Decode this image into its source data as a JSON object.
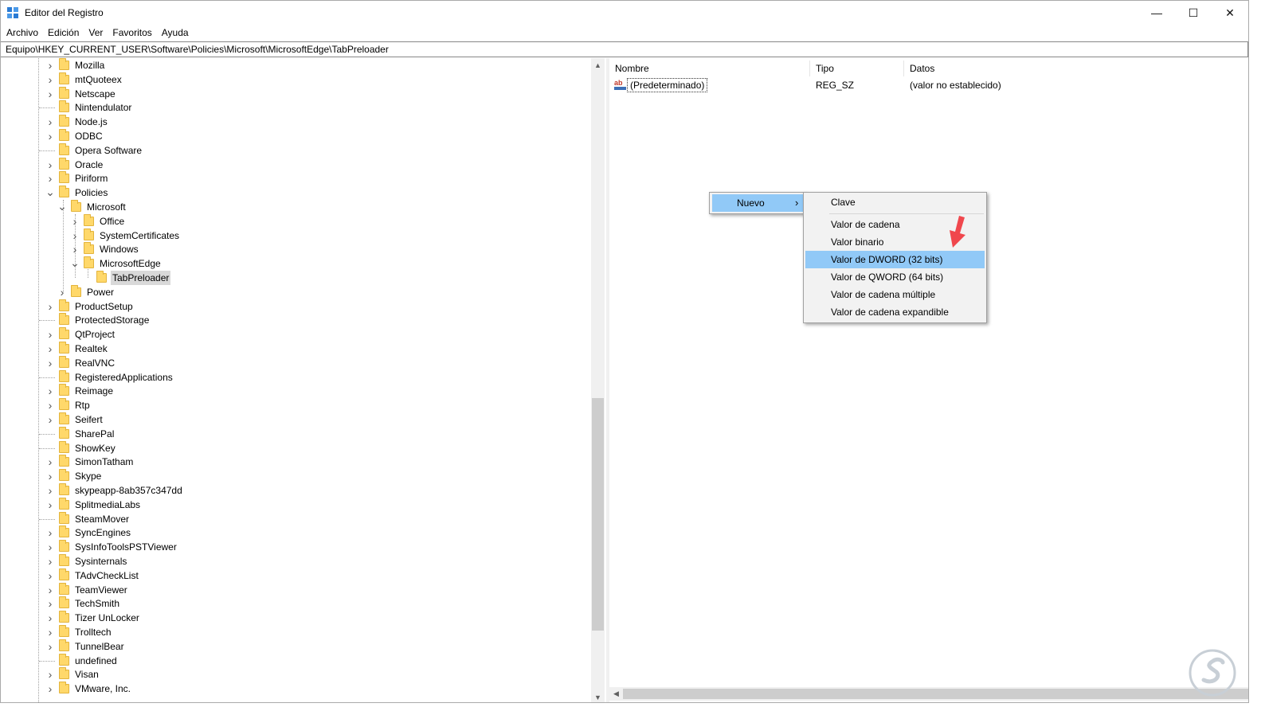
{
  "window": {
    "title": "Editor del Registro",
    "controls": {
      "minimize": "—",
      "maximize": "☐",
      "close": "✕"
    }
  },
  "menu": [
    "Archivo",
    "Edición",
    "Ver",
    "Favoritos",
    "Ayuda"
  ],
  "address": "Equipo\\HKEY_CURRENT_USER\\Software\\Policies\\Microsoft\\MicrosoftEdge\\TabPreloader",
  "tree": [
    {
      "label": "Mozilla",
      "level": 0,
      "expander": "collapsed"
    },
    {
      "label": "mtQuoteex",
      "level": 0,
      "expander": "collapsed"
    },
    {
      "label": "Netscape",
      "level": 0,
      "expander": "collapsed"
    },
    {
      "label": "Nintendulator",
      "level": 0,
      "expander": "none"
    },
    {
      "label": "Node.js",
      "level": 0,
      "expander": "collapsed"
    },
    {
      "label": "ODBC",
      "level": 0,
      "expander": "collapsed"
    },
    {
      "label": "Opera Software",
      "level": 0,
      "expander": "none"
    },
    {
      "label": "Oracle",
      "level": 0,
      "expander": "collapsed"
    },
    {
      "label": "Piriform",
      "level": 0,
      "expander": "collapsed"
    },
    {
      "label": "Policies",
      "level": 0,
      "expander": "expanded"
    },
    {
      "label": "Microsoft",
      "level": 1,
      "expander": "expanded"
    },
    {
      "label": "Office",
      "level": 2,
      "expander": "collapsed"
    },
    {
      "label": "SystemCertificates",
      "level": 2,
      "expander": "collapsed"
    },
    {
      "label": "Windows",
      "level": 2,
      "expander": "collapsed"
    },
    {
      "label": "MicrosoftEdge",
      "level": 2,
      "expander": "expanded"
    },
    {
      "label": "TabPreloader",
      "level": 3,
      "expander": "none",
      "selected": true
    },
    {
      "label": "Power",
      "level": 1,
      "expander": "collapsed"
    },
    {
      "label": "ProductSetup",
      "level": 0,
      "expander": "collapsed"
    },
    {
      "label": "ProtectedStorage",
      "level": 0,
      "expander": "none"
    },
    {
      "label": "QtProject",
      "level": 0,
      "expander": "collapsed"
    },
    {
      "label": "Realtek",
      "level": 0,
      "expander": "collapsed"
    },
    {
      "label": "RealVNC",
      "level": 0,
      "expander": "collapsed"
    },
    {
      "label": "RegisteredApplications",
      "level": 0,
      "expander": "none"
    },
    {
      "label": "Reimage",
      "level": 0,
      "expander": "collapsed"
    },
    {
      "label": "Rtp",
      "level": 0,
      "expander": "collapsed"
    },
    {
      "label": "Seifert",
      "level": 0,
      "expander": "collapsed"
    },
    {
      "label": "SharePal",
      "level": 0,
      "expander": "none"
    },
    {
      "label": "ShowKey",
      "level": 0,
      "expander": "none"
    },
    {
      "label": "SimonTatham",
      "level": 0,
      "expander": "collapsed"
    },
    {
      "label": "Skype",
      "level": 0,
      "expander": "collapsed"
    },
    {
      "label": "skypeapp-8ab357c347dd",
      "level": 0,
      "expander": "collapsed"
    },
    {
      "label": "SplitmediaLabs",
      "level": 0,
      "expander": "collapsed"
    },
    {
      "label": "SteamMover",
      "level": 0,
      "expander": "none"
    },
    {
      "label": "SyncEngines",
      "level": 0,
      "expander": "collapsed"
    },
    {
      "label": "SysInfoToolsPSTViewer",
      "level": 0,
      "expander": "collapsed"
    },
    {
      "label": "Sysinternals",
      "level": 0,
      "expander": "collapsed"
    },
    {
      "label": "TAdvCheckList",
      "level": 0,
      "expander": "collapsed"
    },
    {
      "label": "TeamViewer",
      "level": 0,
      "expander": "collapsed"
    },
    {
      "label": "TechSmith",
      "level": 0,
      "expander": "collapsed"
    },
    {
      "label": "Tizer UnLocker",
      "level": 0,
      "expander": "collapsed"
    },
    {
      "label": "Trolltech",
      "level": 0,
      "expander": "collapsed"
    },
    {
      "label": "TunnelBear",
      "level": 0,
      "expander": "collapsed"
    },
    {
      "label": "undefined",
      "level": 0,
      "expander": "none"
    },
    {
      "label": "Visan",
      "level": 0,
      "expander": "collapsed"
    },
    {
      "label": "VMware, Inc.",
      "level": 0,
      "expander": "collapsed"
    }
  ],
  "list": {
    "columns": [
      "Nombre",
      "Tipo",
      "Datos"
    ],
    "rows": [
      {
        "name": "(Predeterminado)",
        "type": "REG_SZ",
        "data": "(valor no establecido)",
        "icon": "ab"
      }
    ]
  },
  "context_menu": {
    "parent_item": "Nuevo",
    "parent_arrow": "›",
    "submenu": [
      {
        "label": "Clave"
      },
      {
        "label": "Valor de cadena"
      },
      {
        "label": "Valor binario"
      },
      {
        "label": "Valor de DWORD (32 bits)",
        "highlighted": true
      },
      {
        "label": "Valor de QWORD (64 bits)"
      },
      {
        "label": "Valor de cadena múltiple"
      },
      {
        "label": "Valor de cadena expandible"
      }
    ]
  },
  "colors": {
    "highlight": "#91c9f7",
    "annotation_arrow": "#f0474d"
  },
  "icons": {
    "app": "registry-editor-icon",
    "folder": "folder-icon",
    "value": "string-value-icon",
    "watermark": "logo-icon"
  }
}
